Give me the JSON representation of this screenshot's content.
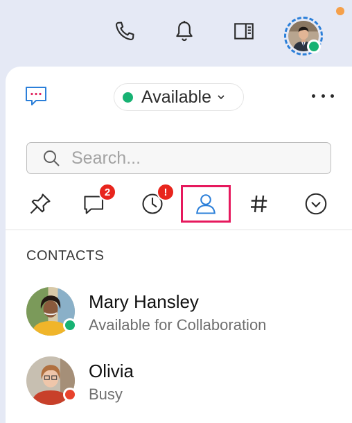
{
  "colors": {
    "accent": "#2b7fd9",
    "available": "#17b273",
    "busy": "#e8432d",
    "notification": "#f5a04a",
    "badge": "#e8251d",
    "active_tab_border": "#e6195d"
  },
  "topbar": {
    "icons": [
      "phone-icon",
      "bell-icon",
      "sidebar-panel-icon"
    ],
    "profile_status": "available"
  },
  "header": {
    "presence_label": "Available",
    "presence_status": "available"
  },
  "search": {
    "placeholder": "Search..."
  },
  "tabs": [
    {
      "name": "pin-icon",
      "badge": ""
    },
    {
      "name": "chat-icon",
      "badge": "2"
    },
    {
      "name": "recent-icon",
      "badge": "!"
    },
    {
      "name": "contacts-icon",
      "badge": "",
      "active": true
    },
    {
      "name": "channels-icon",
      "badge": ""
    },
    {
      "name": "more-tabs-icon",
      "badge": ""
    }
  ],
  "contacts": {
    "title": "CONTACTS",
    "items": [
      {
        "name": "Mary Hansley",
        "status": "Available for Collaboration",
        "presence": "available"
      },
      {
        "name": "Olivia",
        "status": "Busy",
        "presence": "busy"
      }
    ]
  }
}
